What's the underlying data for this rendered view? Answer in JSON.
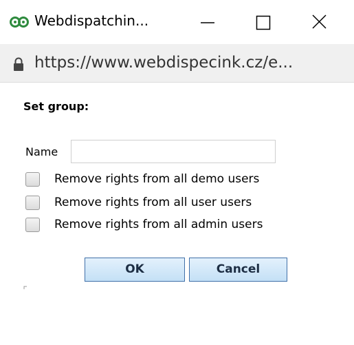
{
  "window": {
    "title": "Webdispatchin...",
    "url_prefix": "https://www.",
    "url_domain": "webdispecink.cz",
    "url_suffix": "/e..."
  },
  "dialog": {
    "heading": "Set group:",
    "name_label": "Name",
    "name_value": "",
    "options": [
      {
        "label": "Remove rights from all demo users",
        "checked": false
      },
      {
        "label": "Remove rights from all user users",
        "checked": false
      },
      {
        "label": "Remove rights from all admin users",
        "checked": false
      }
    ],
    "ok_label": "OK",
    "cancel_label": "Cancel"
  },
  "colors": {
    "app_icon": "#2e8b3e",
    "address_bar_bg": "#f0f0f0",
    "button_border": "#3f6fa8",
    "button_fill": "#c4e0f6"
  },
  "icons": [
    "app-logo-icon",
    "minimize-icon",
    "maximize-icon",
    "close-icon",
    "lock-icon"
  ]
}
